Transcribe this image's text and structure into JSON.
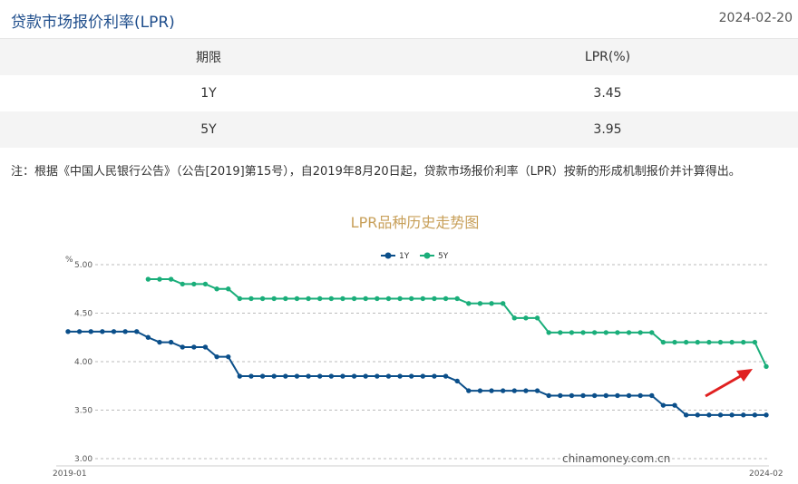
{
  "header": {
    "title": "贷款市场报价利率(LPR)",
    "date": "2024-02-20"
  },
  "table": {
    "headers": [
      "期限",
      "LPR(%)"
    ],
    "rows": [
      {
        "term": "1Y",
        "rate": "3.45"
      },
      {
        "term": "5Y",
        "rate": "3.95"
      }
    ]
  },
  "note": "注：根据《中国人民银行公告》（公告[2019]第15号），自2019年8月20日起，贷款市场报价利率（LPR）按新的形成机制报价并计算得出。",
  "watermark": "chinamoney.com.cn",
  "colors": {
    "accent": "#1f4e8c",
    "series_1y": "#0b4f8a",
    "series_5y": "#1aae7a",
    "arrow": "#e02020"
  },
  "chart_data": {
    "type": "line",
    "title": "LPR品种历史走势图",
    "ylabel": "%",
    "ylim": [
      3.0,
      5.0
    ],
    "yticks": [
      "5.00",
      "4.50",
      "4.00",
      "3.50",
      "3.00"
    ],
    "x_start_label": "2019-01",
    "x_end_label": "2024-02",
    "grid": true,
    "legend_position": "top",
    "series": [
      {
        "name": "1Y",
        "values": [
          4.31,
          4.31,
          4.31,
          4.31,
          4.31,
          4.31,
          4.31,
          4.25,
          4.2,
          4.2,
          4.15,
          4.15,
          4.15,
          4.05,
          4.05,
          3.85,
          3.85,
          3.85,
          3.85,
          3.85,
          3.85,
          3.85,
          3.85,
          3.85,
          3.85,
          3.85,
          3.85,
          3.85,
          3.85,
          3.85,
          3.85,
          3.85,
          3.85,
          3.85,
          3.8,
          3.7,
          3.7,
          3.7,
          3.7,
          3.7,
          3.7,
          3.7,
          3.65,
          3.65,
          3.65,
          3.65,
          3.65,
          3.65,
          3.65,
          3.65,
          3.65,
          3.65,
          3.55,
          3.55,
          3.45,
          3.45,
          3.45,
          3.45,
          3.45,
          3.45,
          3.45,
          3.45
        ]
      },
      {
        "name": "5Y",
        "values": [
          null,
          null,
          null,
          null,
          null,
          null,
          null,
          4.85,
          4.85,
          4.85,
          4.8,
          4.8,
          4.8,
          4.75,
          4.75,
          4.65,
          4.65,
          4.65,
          4.65,
          4.65,
          4.65,
          4.65,
          4.65,
          4.65,
          4.65,
          4.65,
          4.65,
          4.65,
          4.65,
          4.65,
          4.65,
          4.65,
          4.65,
          4.65,
          4.65,
          4.6,
          4.6,
          4.6,
          4.6,
          4.45,
          4.45,
          4.45,
          4.3,
          4.3,
          4.3,
          4.3,
          4.3,
          4.3,
          4.3,
          4.3,
          4.3,
          4.3,
          4.2,
          4.2,
          4.2,
          4.2,
          4.2,
          4.2,
          4.2,
          4.2,
          4.2,
          3.95
        ]
      }
    ]
  }
}
